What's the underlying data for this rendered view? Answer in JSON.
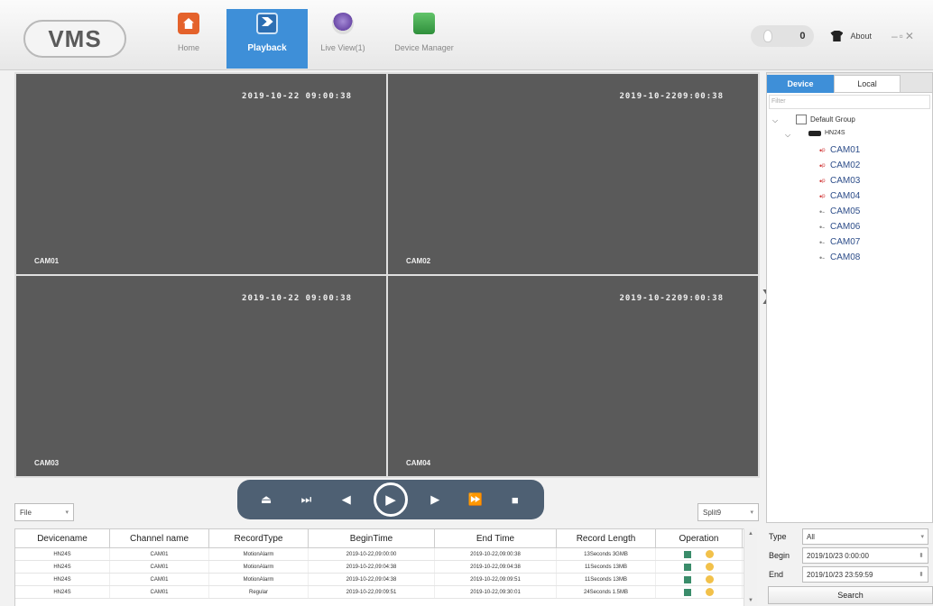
{
  "header": {
    "logo": "VMS",
    "nav": [
      {
        "label": "Home"
      },
      {
        "label": "Playback"
      },
      {
        "label": "Live View(1)"
      },
      {
        "label": "Device Manager"
      }
    ],
    "alarm_count": "0",
    "about_label": "About",
    "window_controls": "–▫✕"
  },
  "video": {
    "tiles": [
      {
        "timestamp": "2019-10-22 09:00:38",
        "camera": "CAM01"
      },
      {
        "timestamp": "2019-10-2209:00:38",
        "camera": "CAM02"
      },
      {
        "timestamp": "2019-10-22 09:00:38",
        "camera": "CAM03"
      },
      {
        "timestamp": "2019-10-2209:00:38",
        "camera": "CAM04"
      }
    ]
  },
  "right_panel": {
    "tabs": [
      "Device",
      "Local"
    ],
    "filter_placeholder": "Filter",
    "tree": {
      "group": "Default Group",
      "device": "HN24S",
      "cameras": [
        {
          "name": "CAM01",
          "recording": true
        },
        {
          "name": "CAM02",
          "recording": true
        },
        {
          "name": "CAM03",
          "recording": true
        },
        {
          "name": "CAM04",
          "recording": true
        },
        {
          "name": "CAM05",
          "recording": false
        },
        {
          "name": "CAM06",
          "recording": false
        },
        {
          "name": "CAM07",
          "recording": false
        },
        {
          "name": "CAM08",
          "recording": false
        }
      ]
    }
  },
  "controls": {
    "file_select": "File",
    "split_select": "Split9"
  },
  "table": {
    "headers": [
      "Devicename",
      "Channel name",
      "RecordType",
      "BeginTime",
      "End Time",
      "Record Length",
      "Operation"
    ],
    "rows": [
      [
        "HN24S",
        "CAM01",
        "MotionAlarm",
        "2019-10-22,09:00:00",
        "2019-10-22,09:00:38",
        "13Seconds 3GMB"
      ],
      [
        "HN24S",
        "CAM01",
        "MotionAlarm",
        "2019-10-22,09:04:38",
        "2019-10-22,09:04:38",
        "11Seconds 13MB"
      ],
      [
        "HN24S",
        "CAM01",
        "MotionAlarm",
        "2019-10-22,09:04:38",
        "2019-10-22,09:09:51",
        "11Seconds 13MB"
      ],
      [
        "HN24S",
        "CAM01",
        "Regular",
        "2019-10-22,09:09:51",
        "2019-10-22,09:30:01",
        "24Seconds 1.5MB"
      ]
    ]
  },
  "search": {
    "type_label": "Type",
    "type_value": "All",
    "begin_label": "Begin",
    "begin_value": "2019/10/23 0:00:00",
    "end_label": "End",
    "end_value": "2019/10/23 23:59:59",
    "search_button": "Search"
  },
  "colors": {
    "accent": "#3e8fd8",
    "tile_bg": "#5a5a5a",
    "control_bar": "#4e6073"
  }
}
